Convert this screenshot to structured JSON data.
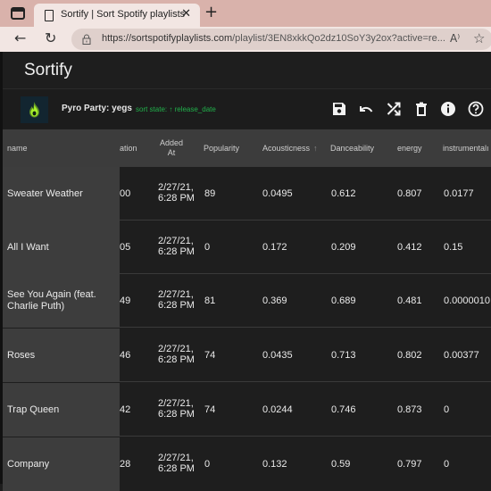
{
  "browser": {
    "tab_title": "Sortify | Sort Spotify playlists",
    "tab_close": "✕",
    "new_tab": "+",
    "back": "←",
    "refresh": "↻",
    "url_host": "https://sortspotifyplaylists.com",
    "url_path": "/playlist/3EN8xkkQo2dz10SoY3y2ox?active=re...",
    "read_aloud": "A⁾",
    "favorites": "☆"
  },
  "app": {
    "title": "Sortify",
    "playlist_name": "Pyro Party: yegs",
    "sort_state": "sort state: ↑ release_date",
    "toolbar": [
      "save-icon",
      "undo-icon",
      "shuffle-icon",
      "delete-icon",
      "info-icon",
      "help-icon"
    ]
  },
  "table": {
    "headers": {
      "name": "name",
      "duration": "ation",
      "added_at_1": "Added",
      "added_at_2": "At",
      "popularity": "Popularity",
      "acousticness": "Acousticness",
      "acousticness_sort": "↑",
      "danceability": "Danceability",
      "energy": "energy",
      "instrumentalness": "instrumentalı"
    },
    "rows": [
      {
        "name": "Sweater Weather",
        "duration": "00",
        "added_1": "2/27/21,",
        "added_2": "6:28 PM",
        "popularity": "89",
        "acousticness": "0.0495",
        "danceability": "0.612",
        "energy": "0.807",
        "instrumentalness": "0.0177"
      },
      {
        "name": "All I Want",
        "duration": "05",
        "added_1": "2/27/21,",
        "added_2": "6:28 PM",
        "popularity": "0",
        "acousticness": "0.172",
        "danceability": "0.209",
        "energy": "0.412",
        "instrumentalness": "0.15"
      },
      {
        "name": "See You Again (feat. Charlie Puth)",
        "duration": "49",
        "added_1": "2/27/21,",
        "added_2": "6:28 PM",
        "popularity": "81",
        "acousticness": "0.369",
        "danceability": "0.689",
        "energy": "0.481",
        "instrumentalness": "0.0000010"
      },
      {
        "name": "Roses",
        "duration": "46",
        "added_1": "2/27/21,",
        "added_2": "6:28 PM",
        "popularity": "74",
        "acousticness": "0.0435",
        "danceability": "0.713",
        "energy": "0.802",
        "instrumentalness": "0.00377"
      },
      {
        "name": "Trap Queen",
        "duration": "42",
        "added_1": "2/27/21,",
        "added_2": "6:28 PM",
        "popularity": "74",
        "acousticness": "0.0244",
        "danceability": "0.746",
        "energy": "0.873",
        "instrumentalness": "0"
      },
      {
        "name": "Company",
        "duration": "28",
        "added_1": "2/27/21,",
        "added_2": "6:28 PM",
        "popularity": "0",
        "acousticness": "0.132",
        "danceability": "0.59",
        "energy": "0.797",
        "instrumentalness": "0"
      }
    ]
  },
  "colors": {
    "accent_green": "#21b04b",
    "flame": "#9be31d",
    "background": "#1e1e1e",
    "header_bg": "#3c3c3c",
    "name_col_bg": "#3d3d3d"
  }
}
